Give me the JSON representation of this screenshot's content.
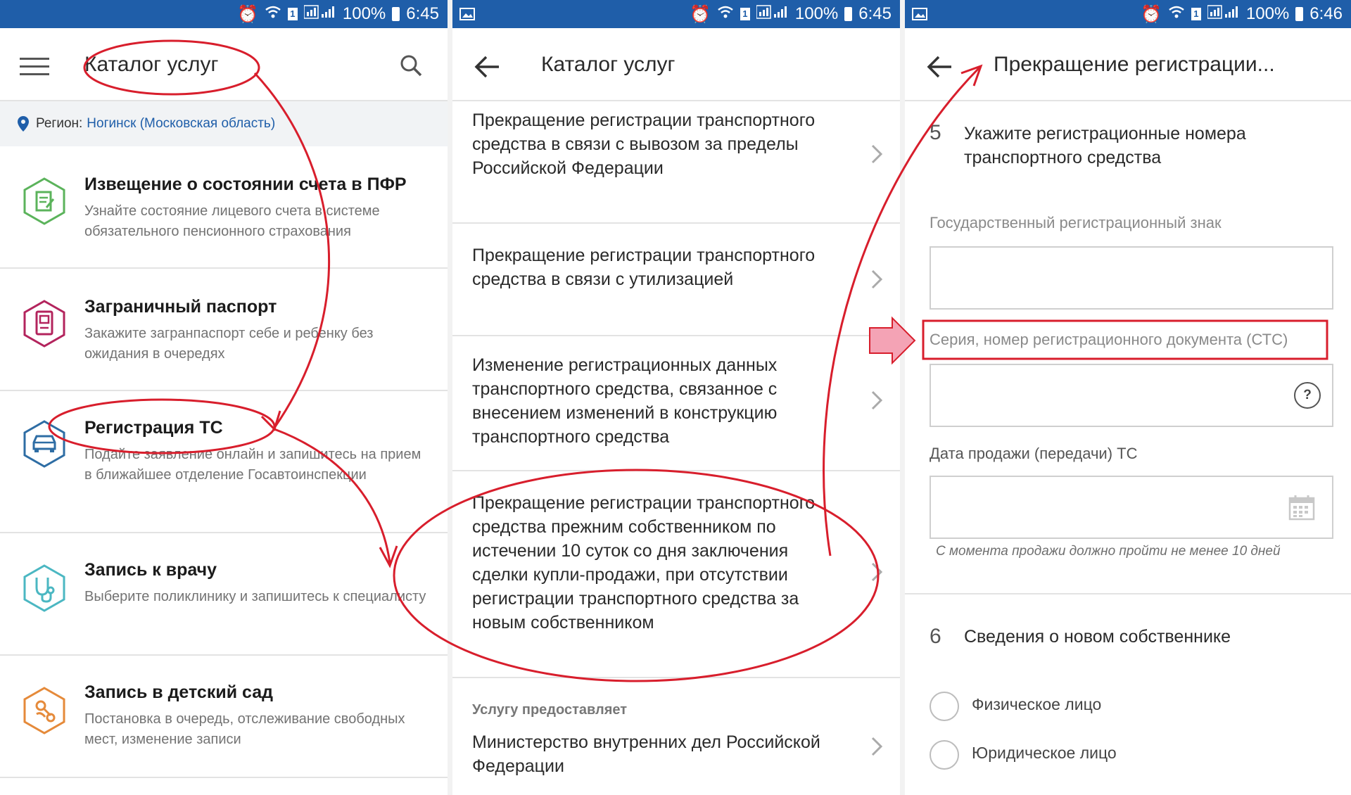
{
  "status": {
    "battery": "100%",
    "time_1": "6:45",
    "time_2": "6:45",
    "time_3": "6:46"
  },
  "screen1": {
    "title": "Каталог услуг",
    "region_label": "Регион:",
    "region_value": "Ногинск (Московская область)",
    "items": [
      {
        "title": "Извещение о состоянии счета в ПФР",
        "desc": "Узнайте состояние лицевого счета в системе обязательного пенсионного страхования",
        "icon": "document-icon",
        "color": "#5bb35b"
      },
      {
        "title": "Заграничный паспорт",
        "desc": "Закажите загранпаспорт себе и ребенку без ожидания в очередях",
        "icon": "passport-icon",
        "color": "#b3245d"
      },
      {
        "title": "Регистрация ТС",
        "desc": "Подайте заявление онлайн и запишитесь на прием в ближайшее отделение Госавтоинспекции",
        "icon": "car-icon",
        "color": "#2e6da4"
      },
      {
        "title": "Запись к врачу",
        "desc": "Выберите поликлинику и запишитесь к специалисту",
        "icon": "stethoscope-icon",
        "color": "#4bb7c2"
      },
      {
        "title": "Запись в детский сад",
        "desc": "Постановка в очередь, отслеживание свободных мест, изменение записи",
        "icon": "pacifier-icon",
        "color": "#e58a3a"
      }
    ]
  },
  "screen2": {
    "title": "Каталог услуг",
    "items": [
      {
        "text": "Прекращение регистрации транспортного средства в связи с вывозом за пределы Российской Федерации"
      },
      {
        "text": "Прекращение регистрации транспортного средства в связи с утилизацией"
      },
      {
        "text": "Изменение регистрационных данных транспортного средства, связанное с внесением изменений в конструкцию транспортного средства"
      },
      {
        "text": "Прекращение регистрации транспортного средства прежним собственником по истечении 10 суток со дня заключения сделки купли-продажи, при отсутствии регистрации транспортного средства за новым собственником"
      }
    ],
    "provider_label": "Услугу предоставляет",
    "provider_name": "Министерство внутренних дел Российской Федерации"
  },
  "screen3": {
    "title": "Прекращение регистрации...",
    "step5_num": "5",
    "step5_title": "Укажите регистрационные номера транспортного средства",
    "field1_label": "Государственный регистрационный знак",
    "field2_label": "Серия, номер регистрационного документа (СТС)",
    "field2_help": "?",
    "field3_label": "Дата продажи (передачи) ТС",
    "field3_hint": "С момента продажи должно пройти не менее 10 дней",
    "step6_num": "6",
    "step6_title": "Сведения о новом собственнике",
    "radio1": "Физическое лицо",
    "radio2": "Юридическое лицо"
  },
  "colors": {
    "statusbar": "#1f5ea9",
    "link": "#1f5ea9",
    "annotation_red": "#d81e2c",
    "annotation_pink": "#f4a3b5"
  }
}
